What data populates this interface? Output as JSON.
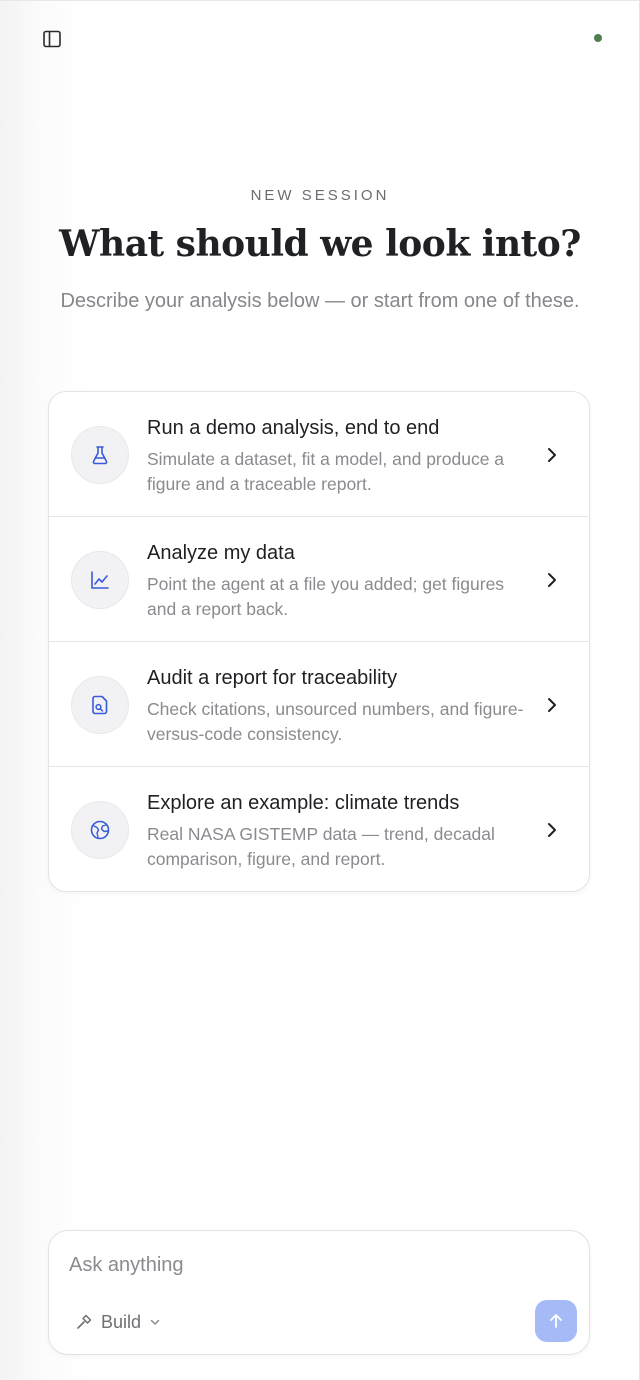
{
  "header": {
    "sidebar_toggle_icon": "sidebar-panel-icon",
    "status_color": "#4f7d52"
  },
  "hero": {
    "eyebrow": "NEW SESSION",
    "title": "What should we look into?",
    "subtitle": "Describe your analysis below — or start from one of these."
  },
  "suggestions": [
    {
      "icon": "flask-icon",
      "title": "Run a demo analysis, end to end",
      "description": "Simulate a dataset, fit a model, and produce a figure and a traceable report."
    },
    {
      "icon": "line-chart-icon",
      "title": "Analyze my data",
      "description": "Point the agent at a file you added; get figures and a report back."
    },
    {
      "icon": "document-search-icon",
      "title": "Audit a report for traceability",
      "description": "Check citations, unsourced numbers, and figure-versus-code consistency."
    },
    {
      "icon": "globe-icon",
      "title": "Explore an example: climate trends",
      "description": "Real NASA GISTEMP data — trend, decadal comparison, figure, and report."
    }
  ],
  "composer": {
    "placeholder": "Ask anything",
    "value": "",
    "mode_label": "Build",
    "mode_icon": "hammer-icon",
    "send_icon": "arrow-up-icon"
  },
  "colors": {
    "accent": "#3a5bd9",
    "send_button": "#a7baf8"
  }
}
